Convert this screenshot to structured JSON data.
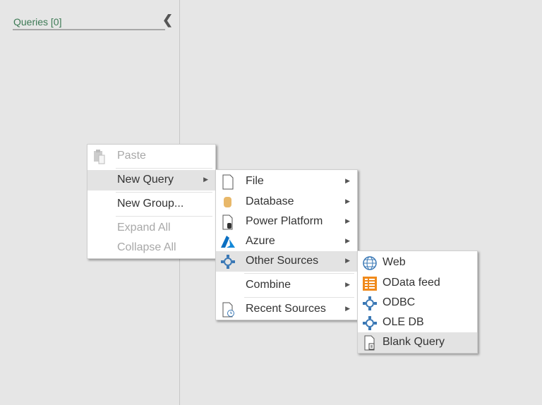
{
  "panel": {
    "title": "Queries [0]"
  },
  "menu1": [
    {
      "label": "Paste",
      "disabled": true
    },
    {
      "label": "New Query",
      "submenu": true
    },
    {
      "label": "New Group..."
    },
    {
      "label": "Expand All",
      "disabled": true
    },
    {
      "label": "Collapse All",
      "disabled": true
    }
  ],
  "menu2": [
    {
      "label": "File",
      "icon": "file-icon"
    },
    {
      "label": "Database",
      "icon": "database-icon"
    },
    {
      "label": "Power Platform",
      "icon": "power-platform-icon"
    },
    {
      "label": "Azure",
      "icon": "azure-icon"
    },
    {
      "label": "Other Sources",
      "icon": "other-sources-icon"
    },
    {
      "label": "Combine"
    },
    {
      "label": "Recent Sources",
      "icon": "recent-sources-icon"
    }
  ],
  "menu3": [
    {
      "label": "Web",
      "icon": "globe-icon"
    },
    {
      "label": "OData feed",
      "icon": "odata-icon"
    },
    {
      "label": "ODBC",
      "icon": "connector-icon"
    },
    {
      "label": "OLE DB",
      "icon": "connector-icon"
    },
    {
      "label": "Blank Query",
      "icon": "blank-query-icon"
    }
  ],
  "colors": {
    "accent": "#3d7a55",
    "azure": "#0a6fc2",
    "connector": "#3a78b5",
    "odata": "#f08a1c",
    "database": "#e8b86a"
  }
}
